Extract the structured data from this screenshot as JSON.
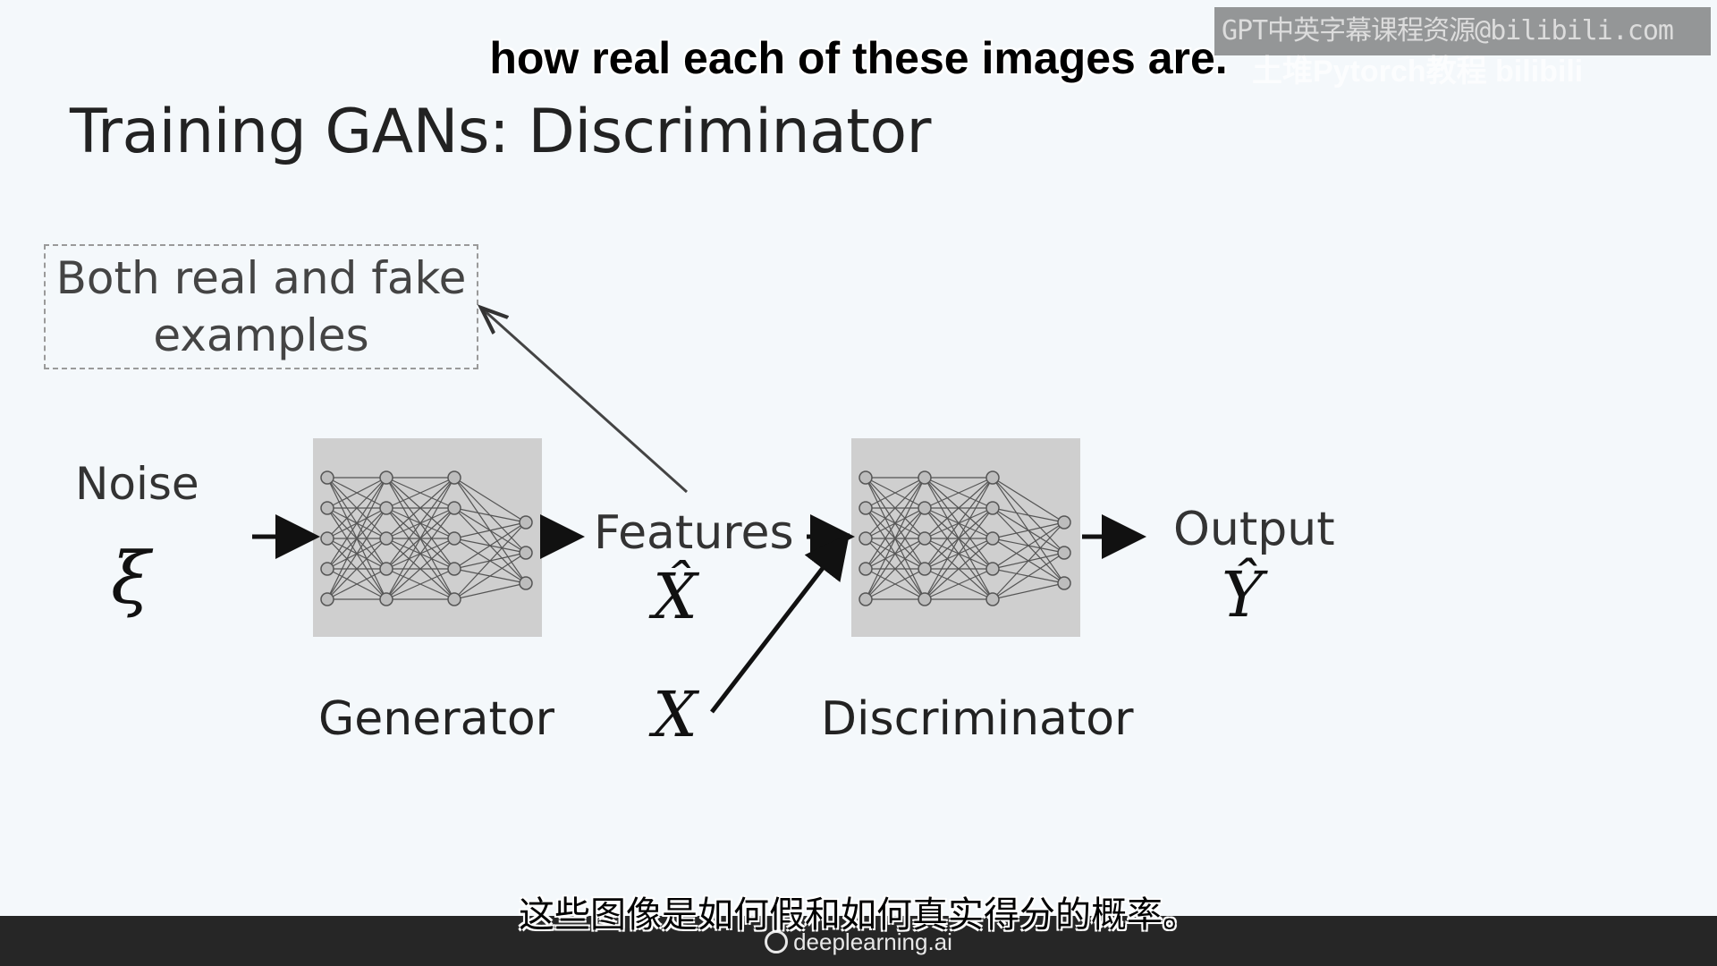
{
  "slide": {
    "title": "Training GANs: Discriminator",
    "box_text_line1": "Both real and fake",
    "box_text_line2": "examples",
    "noise_label": "Noise",
    "noise_symbol": "ξ",
    "generator_label": "Generator",
    "features_label": "Features",
    "features_symbol": "X̂",
    "real_symbol": "X",
    "discriminator_label": "Discriminator",
    "output_label": "Output",
    "output_symbol": "Ŷ"
  },
  "subtitles": {
    "english": "how real each of these images are.",
    "chinese": "这些图像是如何假和如何真实得分的概率。"
  },
  "watermark": {
    "text": "GPT中英字幕课程资源@bilibili.com",
    "text2": "土堆Pytorch教程 bilibili"
  },
  "footer": {
    "brand": "deeplearning.ai"
  },
  "colors": {
    "background": "#f4f8fb",
    "network_box": "#cfcfcf",
    "footer_bar": "#262626"
  }
}
